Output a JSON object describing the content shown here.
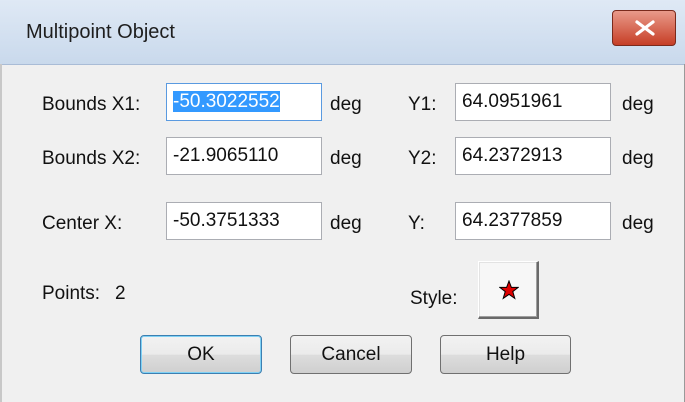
{
  "window": {
    "title": "Multipoint Object"
  },
  "bounds1": {
    "label": "Bounds X1:",
    "x_value": "-50.3022552",
    "x_unit": "deg",
    "y_label": "Y1:",
    "y_value": "64.0951961",
    "y_unit": "deg"
  },
  "bounds2": {
    "label": "Bounds X2:",
    "x_value": "-21.9065110",
    "x_unit": "deg",
    "y_label": "Y2:",
    "y_value": "64.2372913",
    "y_unit": "deg"
  },
  "center": {
    "label": "Center X:",
    "x_value": "-50.3751333",
    "x_unit": "deg",
    "y_label": "Y:",
    "y_value": "64.2377859",
    "y_unit": "deg"
  },
  "points": {
    "label": "Points:",
    "count": "2"
  },
  "style": {
    "label": "Style:",
    "symbol": "red-star-icon",
    "symbol_color": "#e00000"
  },
  "buttons": {
    "ok": "OK",
    "cancel": "Cancel",
    "help": "Help"
  },
  "colors": {
    "selection": "#3399ff",
    "close_button": "#c63e26"
  }
}
